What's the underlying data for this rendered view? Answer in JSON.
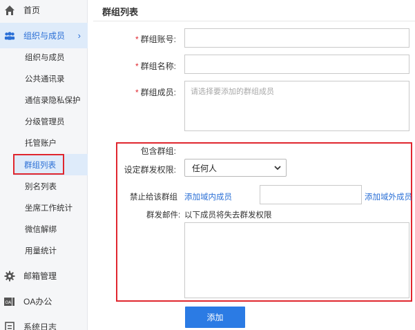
{
  "sidebar": {
    "home": {
      "label": "首页",
      "icon": "home-icon"
    },
    "org": {
      "label": "组织与成员",
      "icon": "users-icon"
    },
    "sub_items": [
      {
        "label": "组织与成员"
      },
      {
        "label": "公共通讯录"
      },
      {
        "label": "通信录隐私保护"
      },
      {
        "label": "分级管理员"
      },
      {
        "label": "托管账户"
      },
      {
        "label": "群组列表"
      },
      {
        "label": "别名列表"
      },
      {
        "label": "坐席工作统计"
      },
      {
        "label": "微信解绑"
      },
      {
        "label": "用量统计"
      }
    ],
    "mailbox": {
      "label": "邮箱管理",
      "icon": "gear-icon"
    },
    "oa": {
      "label": "OA办公",
      "icon": "oa-icon"
    },
    "syslog": {
      "label": "系统日志",
      "icon": "log-icon"
    }
  },
  "main": {
    "title": "群组列表",
    "required_mark": "*",
    "group_account_label": "群组账号:",
    "group_name_label": "群组名称:",
    "group_members_label": "群组成员:",
    "group_members_placeholder": "请选择要添加的群组成员",
    "include_group_label": "包含群组:",
    "permission_label": "设定群发权限:",
    "permission_value": "任何人",
    "forbid_label": "禁止给该群组",
    "add_domain_member": "添加域内成员",
    "add_external_member": "添加域外成员",
    "mass_mail_label": "群发邮件:",
    "mass_mail_note": "以下成员将失去群发权限",
    "add_button": "添加"
  },
  "colors": {
    "accent": "#2b7be4",
    "link": "#2a6fd6",
    "highlight": "#e0262e",
    "required": "#e0262e"
  }
}
